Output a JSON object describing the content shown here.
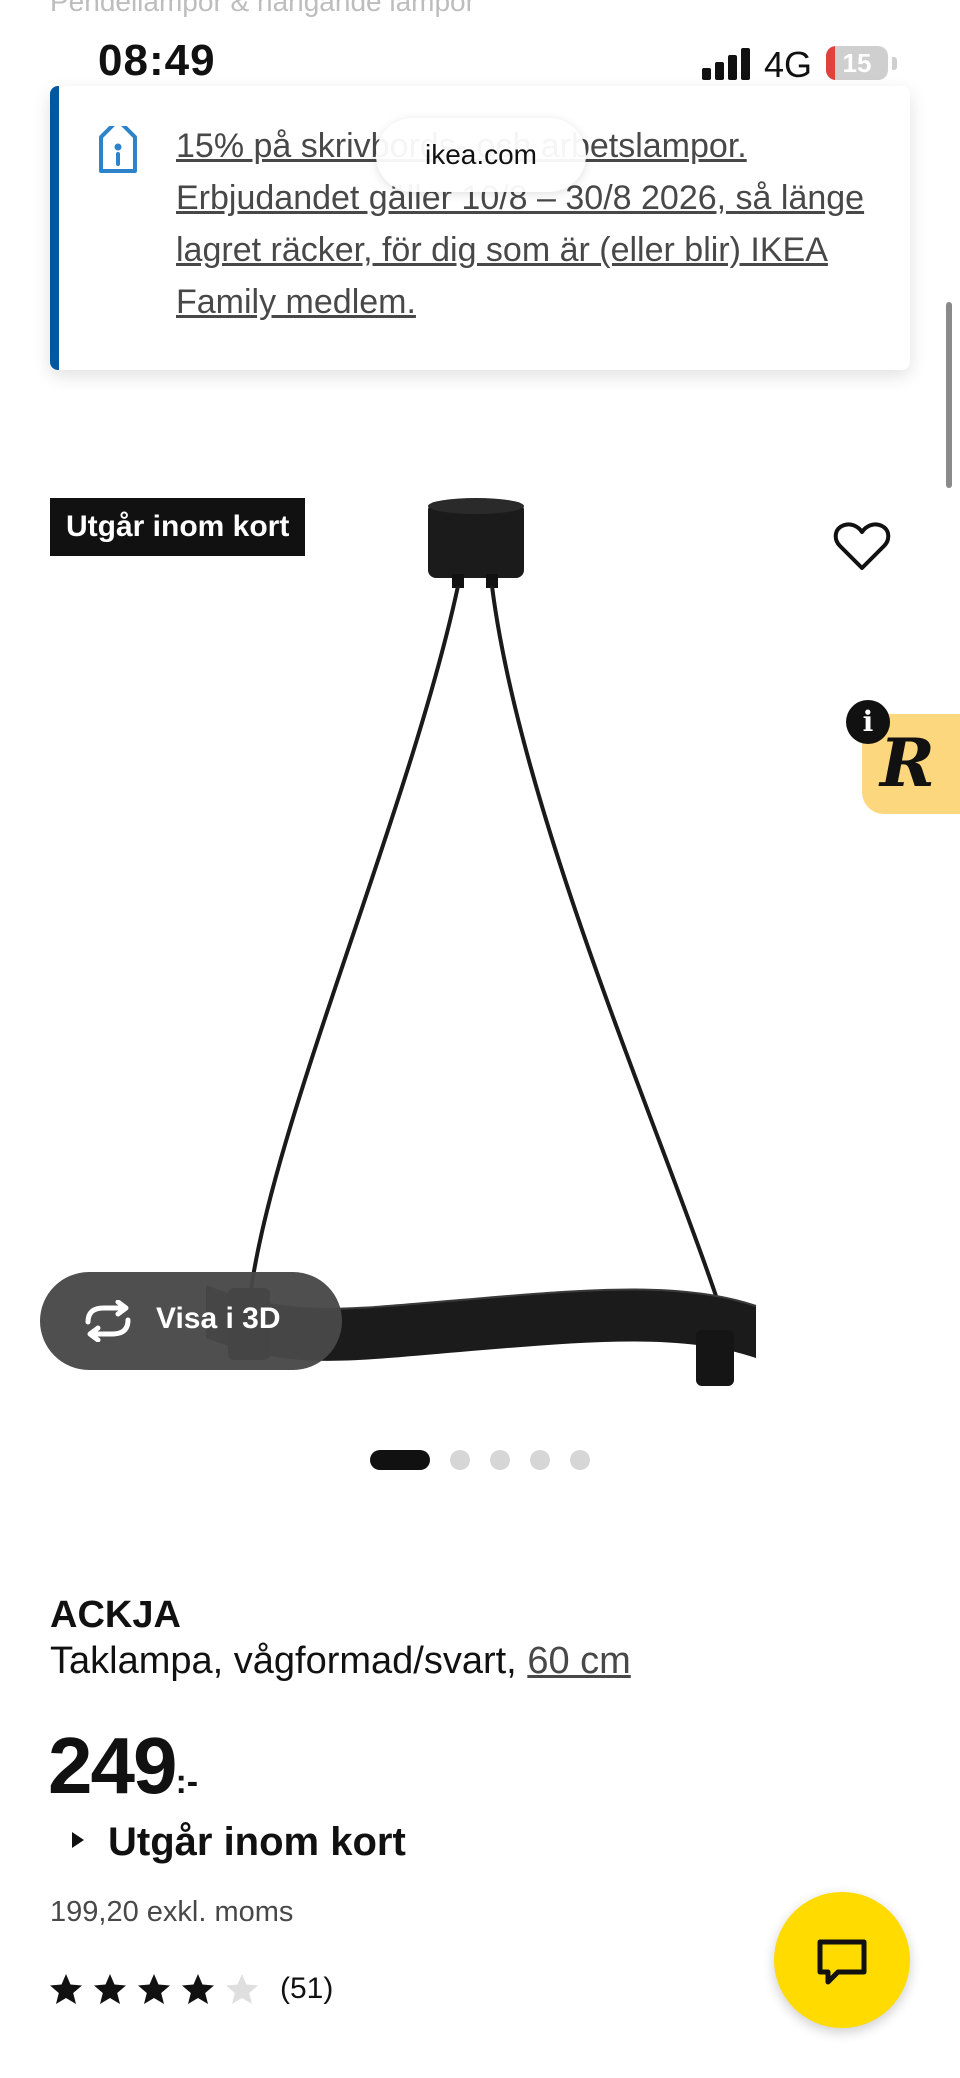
{
  "breadcrumb": {
    "text": "Pendellampor & hängande lampor"
  },
  "status_bar": {
    "time": "08:49",
    "network": "4G",
    "battery_level": "15",
    "battery_fill_fraction": 0.15
  },
  "browser": {
    "url": "ikea.com"
  },
  "promo": {
    "text": "15% på skrivbords- och arbetslampor. Erbjudandet gäller 10/8 – 30/8 2026, så länge lagret räcker, för dig som är (eller blir) IKEA Family medlem.",
    "icon": "tag-icon",
    "accent_color": "#0058a3"
  },
  "product": {
    "badge": "Utgår inom kort",
    "name": "ACKJA",
    "description": "Taklampa, vågformad/svart, ",
    "size": "60 cm",
    "price": "249",
    "price_suffix": ":-",
    "availability": "Utgår inom kort",
    "price_ex_vat": "199,20 exkl. moms",
    "rating": 4,
    "rating_max": 5,
    "review_count": "(51)"
  },
  "media": {
    "view_3d_label": "Visa i 3D",
    "image_count": 5,
    "active_image": 1
  },
  "extension": {
    "letter": "R",
    "info": "i",
    "color": "#fcd77e"
  },
  "chat": {
    "icon": "chat-icon",
    "color": "#ffdb00"
  }
}
